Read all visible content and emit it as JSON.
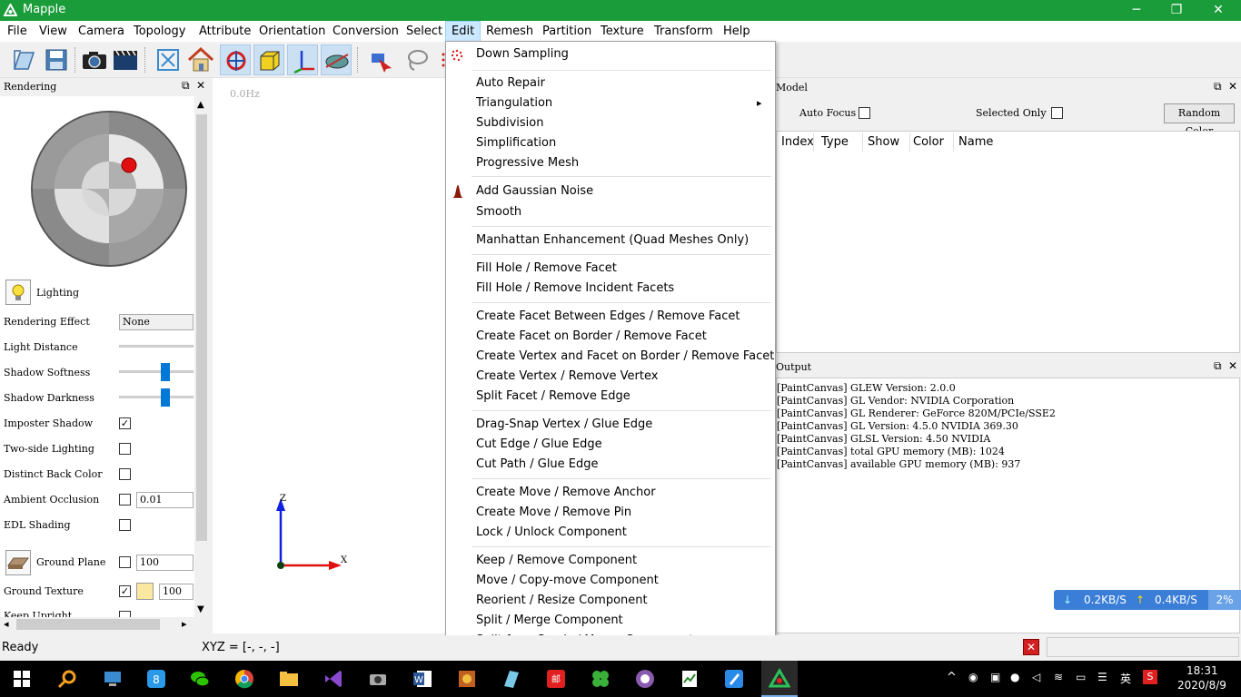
{
  "window": {
    "title": "Mapple",
    "min": "─",
    "restore": "❐",
    "close": "✕"
  },
  "menubar": [
    "File",
    "View",
    "Camera",
    "Topology",
    "Attribute",
    "Orientation",
    "Conversion",
    "Select",
    "Edit",
    "Remesh",
    "Partition",
    "Texture",
    "Transform",
    "Help"
  ],
  "toolbar_icons": [
    "open-icon",
    "save-icon",
    "camera-icon",
    "record-video-icon",
    "fit-view-icon",
    "home-icon",
    "rotate-icon",
    "bounding-box-icon",
    "axes-icon",
    "clipping-plane-icon",
    "selection-tool-icon",
    "lasso-icon",
    "point-select-icon"
  ],
  "rendering_panel": {
    "title": "Rendering",
    "lighting_label": "Lighting",
    "rows": {
      "rendering_effect": {
        "label": "Rendering Effect",
        "value": "None"
      },
      "light_distance": {
        "label": "Light Distance"
      },
      "shadow_softness": {
        "label": "Shadow Softness"
      },
      "shadow_darkness": {
        "label": "Shadow Darkness"
      },
      "imposter_shadow": {
        "label": "Imposter Shadow",
        "checked": true
      },
      "two_side_lighting": {
        "label": "Two-side Lighting",
        "checked": false
      },
      "distinct_back_color": {
        "label": "Distinct Back Color",
        "checked": false
      },
      "ambient_occlusion": {
        "label": "Ambient Occlusion",
        "checked": false,
        "value": "0.01"
      },
      "edl_shading": {
        "label": "EDL Shading",
        "checked": false
      },
      "ground_plane": {
        "label": "Ground Plane",
        "checked": false,
        "value": "100"
      },
      "ground_texture": {
        "label": "Ground Texture",
        "checked": true,
        "value": "100"
      },
      "keep_upright": {
        "label": "Keep Upright",
        "checked": false
      }
    }
  },
  "canvas": {
    "fps": "0.0Hz",
    "axis_x": "X",
    "axis_z": "Z"
  },
  "edit_menu": {
    "groups": [
      [
        "Down Sampling"
      ],
      [
        "Auto Repair",
        "Triangulation",
        "Subdivision",
        "Simplification",
        "Progressive Mesh"
      ],
      [
        "Add Gaussian Noise",
        "Smooth"
      ],
      [
        "Manhattan Enhancement (Quad Meshes Only)"
      ],
      [
        "Fill Hole / Remove Facet",
        "Fill Hole / Remove Incident Facets"
      ],
      [
        "Create Facet Between Edges / Remove Facet",
        "Create Facet on Border / Remove Facet",
        "Create Vertex and Facet on Border / Remove Facet",
        "Create Vertex / Remove Vertex",
        "Split Facet / Remove Edge"
      ],
      [
        "Drag-Snap Vertex / Glue Edge",
        "Cut Edge / Glue Edge",
        "Cut Path / Glue Edge"
      ],
      [
        "Create Move / Remove Anchor",
        "Create Move / Remove Pin",
        "Lock / Unlock Component"
      ],
      [
        "Keep  / Remove Component",
        "Move  / Copy-move Component",
        "Reorient / Resize Component",
        "Split / Merge Component",
        "Split from Seeds / Merge Component"
      ]
    ],
    "submenu_arrow": "▸"
  },
  "model_panel": {
    "title": "Model",
    "auto_focus": "Auto Focus",
    "selected_only": "Selected Only",
    "random_color": "Random Color",
    "columns": [
      "Index",
      "Type",
      "Show",
      "Color",
      "Name"
    ]
  },
  "output_panel": {
    "title": "Output",
    "lines": [
      "[PaintCanvas] GLEW Version: 2.0.0",
      "[PaintCanvas] GL Vendor: NVIDIA Corporation",
      "[PaintCanvas] GL Renderer: GeForce 820M/PCIe/SSE2",
      "[PaintCanvas] GL Version: 4.5.0 NVIDIA 369.30",
      "[PaintCanvas] GLSL Version: 4.50 NVIDIA",
      "[PaintCanvas] total GPU memory (MB): 1024",
      "[PaintCanvas] available GPU memory (MB): 937"
    ]
  },
  "netspeed": {
    "down": "0.2KB/S",
    "up": "0.4KB/S",
    "cpu": "2%"
  },
  "statusbar": {
    "status": "Ready",
    "coords": "XYZ = [-, -, -]"
  },
  "taskbar": {
    "time": "18:31",
    "date": "2020/8/9",
    "ime": "英"
  },
  "colors": {
    "titlebar": "#1b9c3b",
    "accent": "#0078d7",
    "taskbar": "#000000"
  }
}
